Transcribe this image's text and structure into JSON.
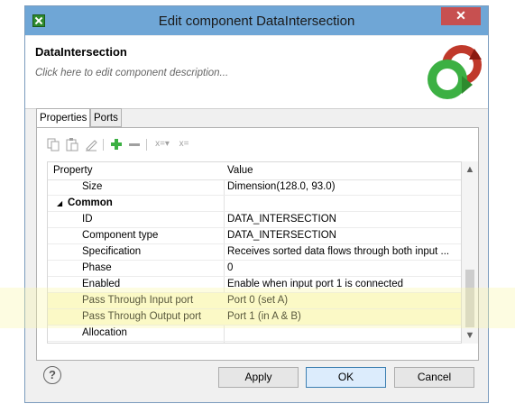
{
  "window": {
    "title": "Edit component DataIntersection",
    "close_glyph": "✕"
  },
  "header": {
    "component_name": "DataIntersection",
    "description_placeholder": "Click here to edit component description...",
    "logo_icon": "data-intersection-arrows-icon"
  },
  "tabs": [
    {
      "label": "Properties",
      "active": true
    },
    {
      "label": "Ports",
      "active": false
    }
  ],
  "toolbar": {
    "icons": [
      "copy-icon",
      "paste-icon",
      "edit-icon",
      "add-icon",
      "remove-icon",
      "edit-attribute-icon",
      "format-icon"
    ],
    "attr_label_1": "x=▾",
    "attr_label_2": "x="
  },
  "table": {
    "headers": {
      "property": "Property",
      "value": "Value"
    },
    "rows": [
      {
        "key": "Size",
        "value": "Dimension(128.0, 93.0)"
      },
      {
        "key": "Common",
        "value": "",
        "group": true
      },
      {
        "key": "ID",
        "value": "DATA_INTERSECTION"
      },
      {
        "key": "Component type",
        "value": "DATA_INTERSECTION"
      },
      {
        "key": "Specification",
        "value": "Receives sorted data flows through both input ..."
      },
      {
        "key": "Phase",
        "value": "0"
      },
      {
        "key": "Enabled",
        "value": "Enable when input port 1 is connected"
      },
      {
        "key": "Pass Through Input port",
        "value": "Port 0 (set A)",
        "highlight": true
      },
      {
        "key": "Pass Through Output port",
        "value": "Port 1 (in A & B)",
        "highlight": true
      },
      {
        "key": "Allocation",
        "value": ""
      }
    ]
  },
  "footer": {
    "help_glyph": "?",
    "apply_label": "Apply",
    "ok_label": "OK",
    "cancel_label": "Cancel"
  },
  "colors": {
    "titlebar": "#6fa6d6",
    "highlight": "#fcfbd6",
    "close": "#c75050"
  }
}
